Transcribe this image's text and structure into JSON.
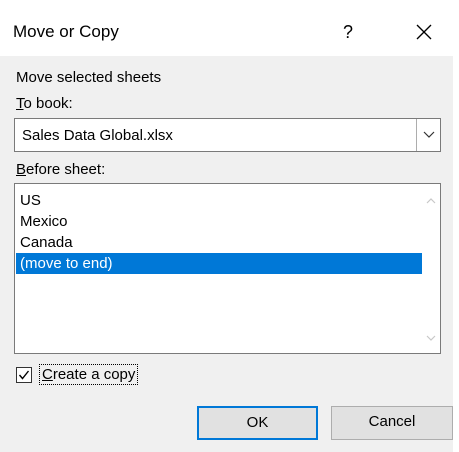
{
  "window": {
    "title": "Move or Copy",
    "help_glyph": "?",
    "close_icon": "close-icon"
  },
  "labels": {
    "move_selected": "Move selected sheets",
    "to_book_first": "T",
    "to_book_rest": "o book:",
    "before_sheet_first": "B",
    "before_sheet_rest": "efore sheet:"
  },
  "to_book": {
    "value": "Sales Data Global.xlsx"
  },
  "before_sheet": {
    "items": [
      {
        "label": "US",
        "selected": false
      },
      {
        "label": "Mexico",
        "selected": false
      },
      {
        "label": "Canada",
        "selected": false
      },
      {
        "label": "(move to end)",
        "selected": true
      }
    ]
  },
  "create_copy": {
    "checked": true,
    "label_first": "C",
    "label_rest": "reate a copy"
  },
  "buttons": {
    "ok": "OK",
    "cancel": "Cancel"
  },
  "colors": {
    "selection": "#0078d7",
    "dialog_bg": "#f0f0f0"
  }
}
